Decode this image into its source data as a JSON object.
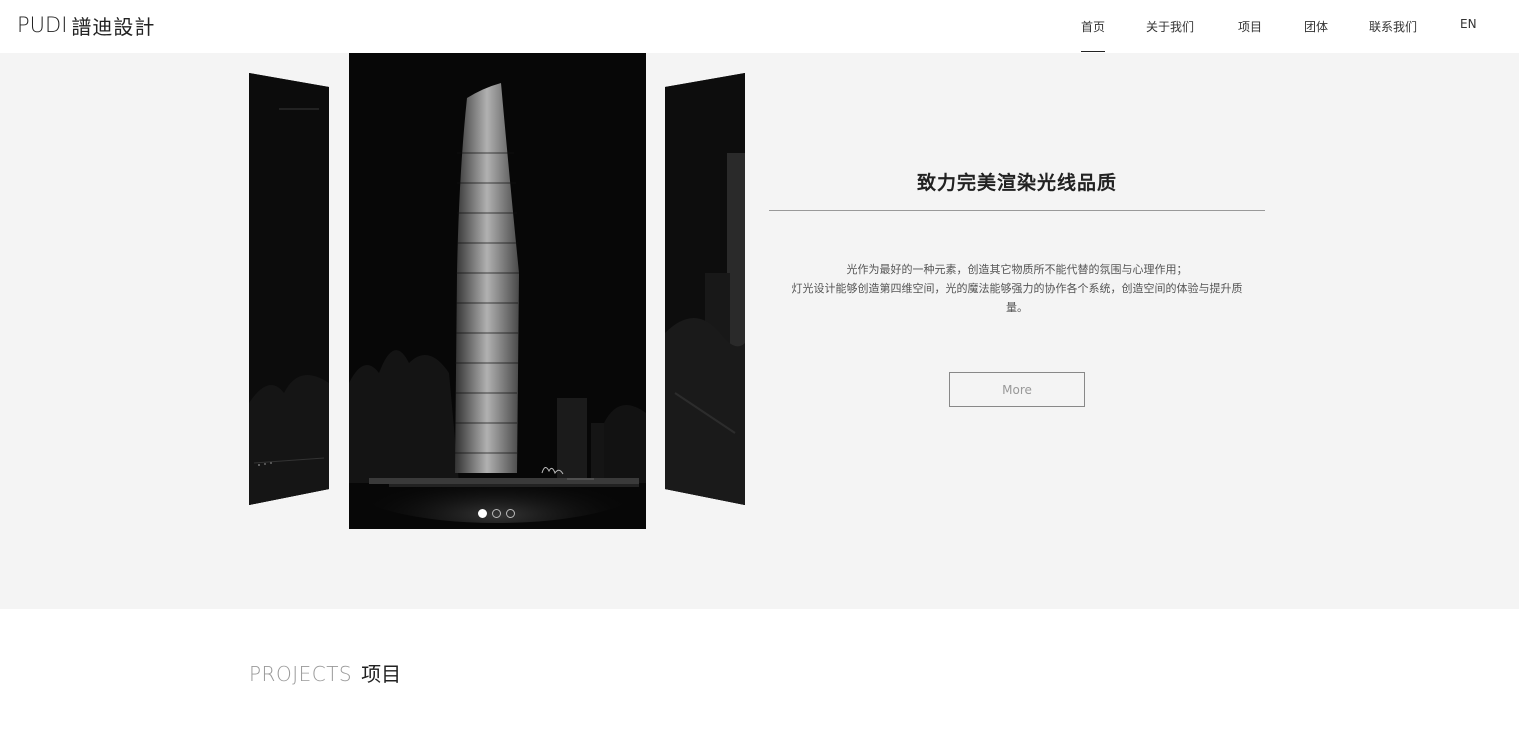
{
  "header": {
    "logo_latin": "PUDI",
    "logo_cjk": "譜迪設計",
    "nav": [
      {
        "label": "首页",
        "active": true
      },
      {
        "label": "关于我们",
        "active": false
      },
      {
        "label": "项目",
        "active": false
      },
      {
        "label": "团体",
        "active": false
      },
      {
        "label": "联系我们",
        "active": false
      },
      {
        "label": "EN",
        "active": false
      }
    ]
  },
  "carousel": {
    "slide_count": 3,
    "active_index": 0,
    "main_image": "night-skyscraper-rendering",
    "signature": "Pudi"
  },
  "hero": {
    "title": "致力完美渲染光线品质",
    "desc_line1": "光作为最好的一种元素，创造其它物质所不能代替的氛围与心理作用；",
    "desc_line2": "灯光设计能够创造第四维空间，光的魔法能够强力的协作各个系统，创造空间的体验与提升质",
    "desc_line3": "量。",
    "more_label": "More"
  },
  "projects": {
    "en": "PROJECTS",
    "cn": "项目"
  },
  "colors": {
    "hero_bg": "#f4f4f4",
    "page_bg": "#ffffff",
    "text_dark": "#222222",
    "text_muted": "#999999"
  }
}
